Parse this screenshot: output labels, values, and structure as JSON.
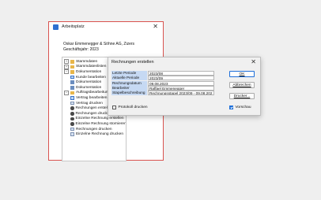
{
  "back_window": {
    "title": "Arbeitsplatz",
    "close_glyph": "✕",
    "company_line": "Oskar Emmenegger & Söhne AG, Zizers",
    "fiscal_year": "Geschäftsjahr: 2023",
    "tree": [
      {
        "label": "Stammdaten",
        "indent": 0,
        "expander": "+",
        "icon": "folder"
      },
      {
        "label": "Stammdatenlisten",
        "indent": 0,
        "expander": "+",
        "icon": "folder"
      },
      {
        "label": "Dokumentation",
        "indent": 0,
        "expander": "−",
        "icon": "folder"
      },
      {
        "label": "Kunde bearbeiten",
        "indent": 1,
        "expander": "",
        "icon": "task"
      },
      {
        "label": "Dokumentation",
        "indent": 1,
        "expander": "",
        "icon": "list"
      },
      {
        "label": "Dokumentation",
        "indent": 1,
        "expander": "",
        "icon": "list"
      },
      {
        "label": "Auftragsbearbeitung",
        "indent": 0,
        "expander": "−",
        "icon": "folder"
      },
      {
        "label": "Vertrag bearbeiten",
        "indent": 1,
        "expander": "",
        "icon": "task"
      },
      {
        "label": "Vertrag drucken",
        "indent": 1,
        "expander": "",
        "icon": "doc"
      },
      {
        "label": "Rechnungen erstellen",
        "indent": 1,
        "expander": "",
        "icon": "gear"
      },
      {
        "label": "Rechnungen drucken",
        "indent": 1,
        "expander": "",
        "icon": "gear"
      },
      {
        "label": "Einzelne Rechnung erstellen",
        "indent": 1,
        "expander": "",
        "icon": "gear"
      },
      {
        "label": "Einzelne Rechnung stornieren",
        "indent": 1,
        "expander": "",
        "icon": "gear"
      },
      {
        "label": "Rechnungen drucken",
        "indent": 1,
        "expander": "",
        "icon": "doc"
      },
      {
        "label": "Einzelne Rechnung drucken",
        "indent": 1,
        "expander": "",
        "icon": "doc"
      }
    ]
  },
  "dialog": {
    "title": "Rechnungen erstellen",
    "close_glyph": "✕",
    "fields": [
      {
        "label": "Letzte Periode",
        "value": "2023/08"
      },
      {
        "label": "Aktuelle Periode",
        "value": "2023/09"
      },
      {
        "label": "Rechnungsdatum",
        "value": "09.08.2023"
      },
      {
        "label": "Bearbeiter",
        "value": "Raffael Emmenegger"
      },
      {
        "label": "Stapelbeschreibung",
        "value": "Rechnungsstapel 2023/09 - 09.08.202"
      }
    ],
    "protocol_label": "Protokoll drucken",
    "protocol_checked": false,
    "ok_label": "OK",
    "cancel_label": "Abbrechen",
    "print_label": "Drucker...",
    "preview_label": "Vorschau",
    "preview_checked": true,
    "accent_color": "#1e6fd9",
    "field_label_color": "#c6d9f3"
  }
}
